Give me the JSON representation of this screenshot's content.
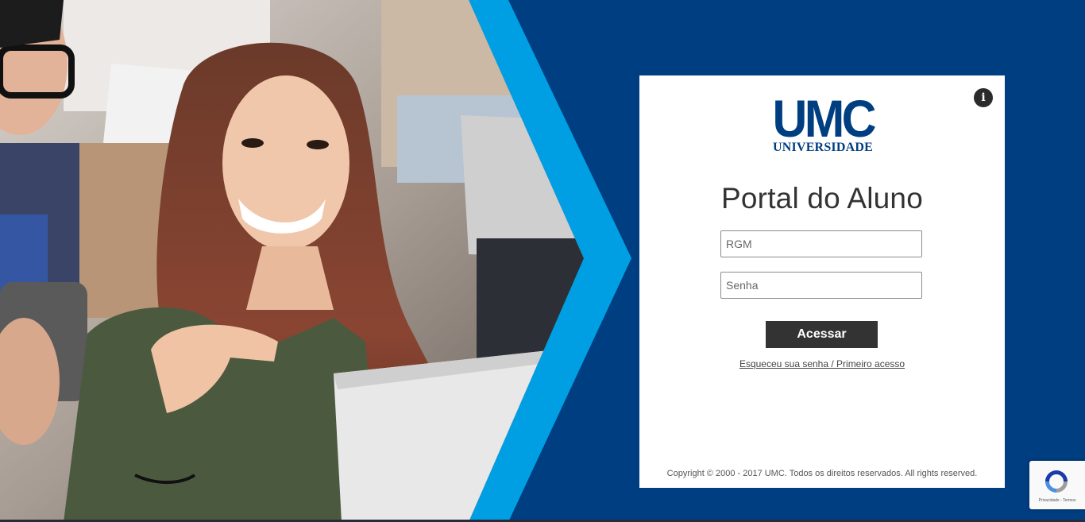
{
  "colors": {
    "background": "#003e82",
    "chevron": "#009fe3",
    "card": "#ffffff",
    "brand_blue": "#003e82",
    "button": "#333333"
  },
  "hero": {
    "icon": "students-photo"
  },
  "logo": {
    "main": "UMC",
    "sub": "UNIVERSIDADE"
  },
  "info_button": {
    "label": "i"
  },
  "login": {
    "title": "Portal do Aluno",
    "rgm_placeholder": "RGM",
    "rgm_value": "",
    "senha_placeholder": "Senha",
    "senha_value": "",
    "submit_label": "Acessar",
    "forgot_link": "Esqueceu sua senha / Primeiro acesso"
  },
  "footer": {
    "copyright": "Copyright © 2000 - 2017 UMC. Todos os direitos reservados. All rights reserved."
  },
  "recaptcha": {
    "icon": "recaptcha-icon",
    "text": "Privacidade - Termos"
  }
}
